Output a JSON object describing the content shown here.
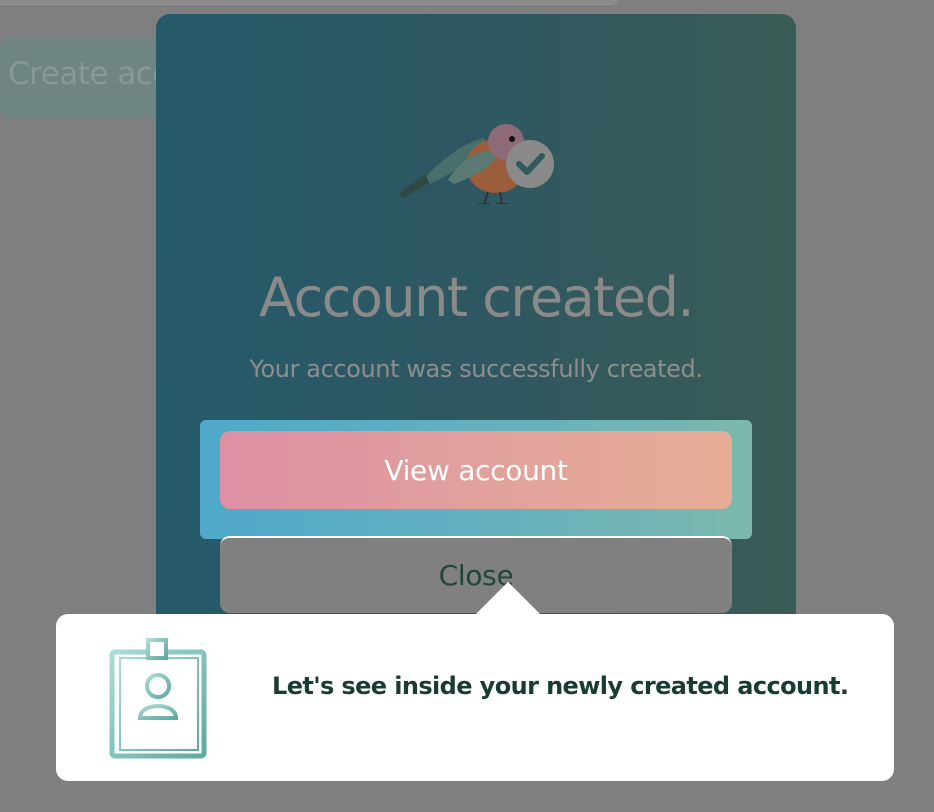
{
  "background": {
    "create_button_label": "Create acco"
  },
  "modal": {
    "title": "Account created.",
    "subtitle": "Your account was successfully created.",
    "view_account_label": "View account",
    "close_label": "Close",
    "icon": "bird-check-icon"
  },
  "tooltip": {
    "text": "Let's see inside your newly created account.",
    "icon": "id-badge-icon"
  },
  "colors": {
    "primary_gradient_start": "#de8fa4",
    "primary_gradient_end": "#e6ad96",
    "modal_bg_start": "#255a6a",
    "modal_bg_end": "#3a5c56",
    "tooltip_text": "#183c33",
    "badge_accent": "#7ec3b8"
  }
}
